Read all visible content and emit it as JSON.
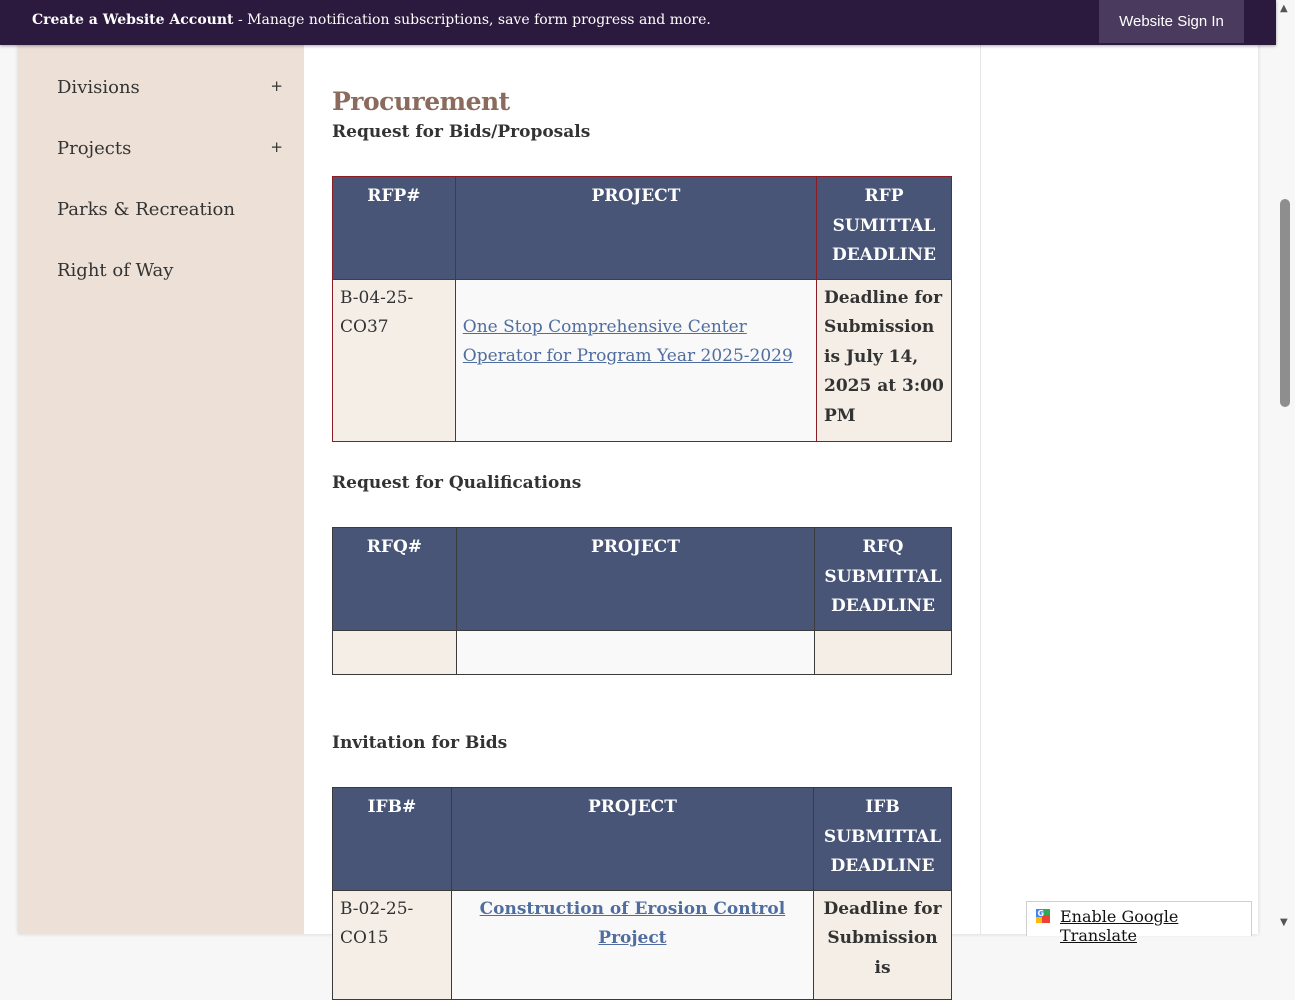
{
  "banner": {
    "account_bold": "Create a Website Account",
    "account_rest": " - Manage notification subscriptions, save form progress and more.",
    "sign_in": "Website Sign In"
  },
  "sidebar": {
    "items": [
      {
        "label": "Divisions",
        "expand": "+"
      },
      {
        "label": "Projects",
        "expand": "+"
      },
      {
        "label": "Parks & Recreation"
      },
      {
        "label": "Right of Way"
      }
    ]
  },
  "main": {
    "title": "Procurement",
    "rfp": {
      "heading": "Request for Bids/Proposals",
      "headers": [
        "RFP#",
        "PROJECT",
        "RFP SUMITTAL DEADLINE"
      ],
      "row": {
        "number": "B-04-25-CO37",
        "project": "One Stop Comprehensive Center Operator for Program Year 2025-2029",
        "deadline": "Deadline for Submission is July 14, 2025 at 3:00 PM"
      }
    },
    "rfq": {
      "heading": "Request for Qualifications",
      "headers": [
        "RFQ#",
        "PROJECT",
        "RFQ SUBMITTAL DEADLINE"
      ]
    },
    "ifb": {
      "heading": "Invitation for Bids",
      "headers": [
        "IFB#",
        "PROJECT",
        "IFB SUBMITTAL DEADLINE"
      ],
      "row": {
        "number": "B-02-25-CO15",
        "project": "Construction of Erosion Control Project",
        "deadline": "Deadline for Submission is"
      }
    }
  },
  "translate": {
    "label": "Enable Google Translate"
  },
  "colors": {
    "banner": "#2b1a3d",
    "sidebar": "#ede0d6",
    "table_header": "#485576",
    "title": "#8a6b5d",
    "link": "#4f6d9e"
  }
}
